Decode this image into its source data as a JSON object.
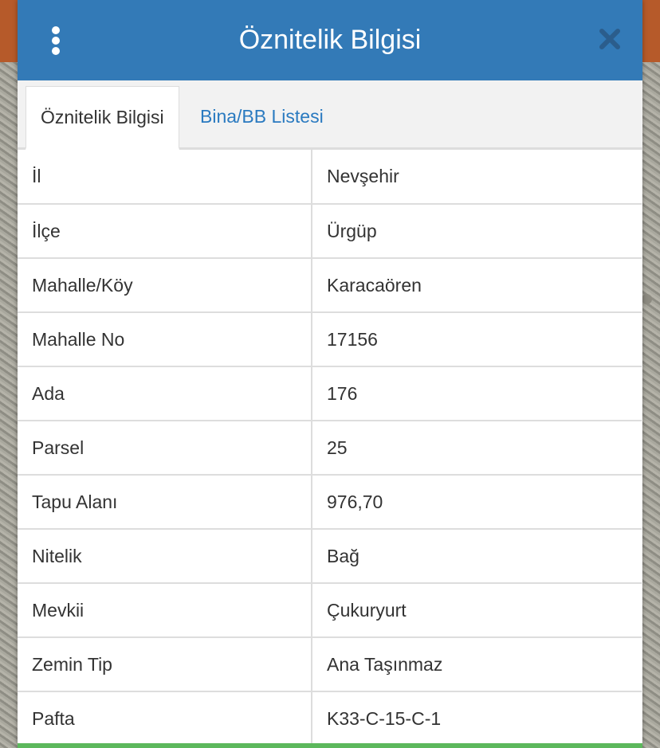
{
  "dialog": {
    "title": "Öznitelik Bilgisi"
  },
  "tabs": [
    {
      "label": "Öznitelik Bilgisi",
      "active": true
    },
    {
      "label": "Bina/BB Listesi",
      "active": false
    }
  ],
  "attributes": [
    {
      "label": "İl",
      "value": "Nevşehir"
    },
    {
      "label": "İlçe",
      "value": "Ürgüp"
    },
    {
      "label": "Mahalle/Köy",
      "value": "Karacaören"
    },
    {
      "label": "Mahalle No",
      "value": "17156"
    },
    {
      "label": "Ada",
      "value": "176"
    },
    {
      "label": "Parsel",
      "value": "25"
    },
    {
      "label": "Tapu Alanı",
      "value": "976,70"
    },
    {
      "label": "Nitelik",
      "value": "Bağ"
    },
    {
      "label": "Mevkii",
      "value": "Çukuryurt"
    },
    {
      "label": "Zemin Tip",
      "value": "Ana Taşınmaz"
    },
    {
      "label": "Pafta",
      "value": "K33-C-15-C-1"
    }
  ],
  "colors": {
    "header": "#337ab7",
    "link": "#2a7ac0",
    "accent_line": "#5cb85c"
  },
  "icons": {
    "menu": "more-vertical-icon",
    "close": "close-icon"
  }
}
